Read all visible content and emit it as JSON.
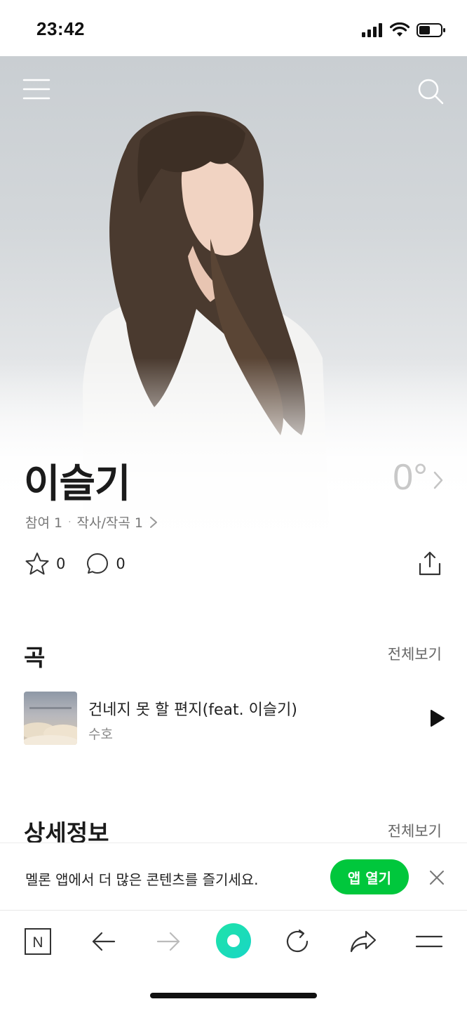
{
  "status_bar": {
    "time": "23:42"
  },
  "artist": {
    "name": "이슬기",
    "temperature": "0°",
    "meta": {
      "participation": "참여 1",
      "songwriting": "작사/작곡 1"
    },
    "stats": {
      "likes": "0",
      "comments": "0"
    }
  },
  "songs_section": {
    "title": "곡",
    "see_all": "전체보기",
    "items": [
      {
        "title": "건네지 못 할 편지(feat. 이슬기)",
        "artist": "수호"
      }
    ]
  },
  "details_section": {
    "title": "상세정보",
    "see_all": "전체보기"
  },
  "app_banner": {
    "text": "멜론 앱에서 더 많은 콘텐츠를 즐기세요.",
    "button": "앱 열기"
  },
  "toolbar": {
    "home_label": "N"
  },
  "colors": {
    "accent_green": "#00c73c",
    "toolbar_accent": "#1ee3a8"
  }
}
